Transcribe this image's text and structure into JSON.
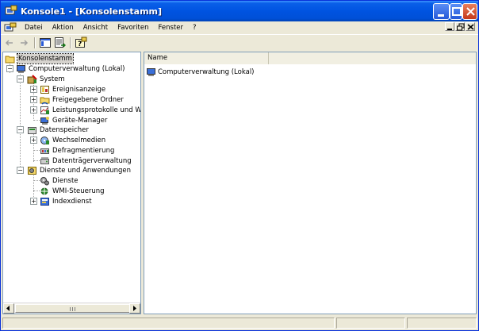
{
  "window": {
    "title": "Konsole1 - [Konsolenstamm]"
  },
  "menu": {
    "items": [
      "Datei",
      "Aktion",
      "Ansicht",
      "Favoriten",
      "Fenster",
      "?"
    ]
  },
  "toolbar": {
    "tools": [
      "back-icon",
      "forward-icon",
      "show-hide-console-tree-icon",
      "export-list-icon",
      "help-icon"
    ]
  },
  "tree": {
    "root": "Konsolenstamm",
    "computer": "Computerverwaltung (Lokal)",
    "system": "System",
    "ereignis": "Ereignisanzeige",
    "freigabe": "Freigegebene Ordner",
    "leistung": "Leistungsprotokolle und Warn",
    "geraete": "Geräte-Manager",
    "datenspeicher": "Datenspeicher",
    "wechselmedien": "Wechselmedien",
    "defrag": "Defragmentierung",
    "datentraeger": "Datenträgerverwaltung",
    "dienste_anw": "Dienste und Anwendungen",
    "dienste": "Dienste",
    "wmi": "WMI-Steuerung",
    "index": "Indexdienst",
    "expander_plus": "+",
    "expander_minus": "−"
  },
  "list": {
    "columns": [
      "Name",
      ""
    ],
    "rows": [
      "Computerverwaltung (Lokal)"
    ]
  },
  "colors": {
    "titlebar": "#0053e1",
    "selection": "#d6d3ce"
  }
}
